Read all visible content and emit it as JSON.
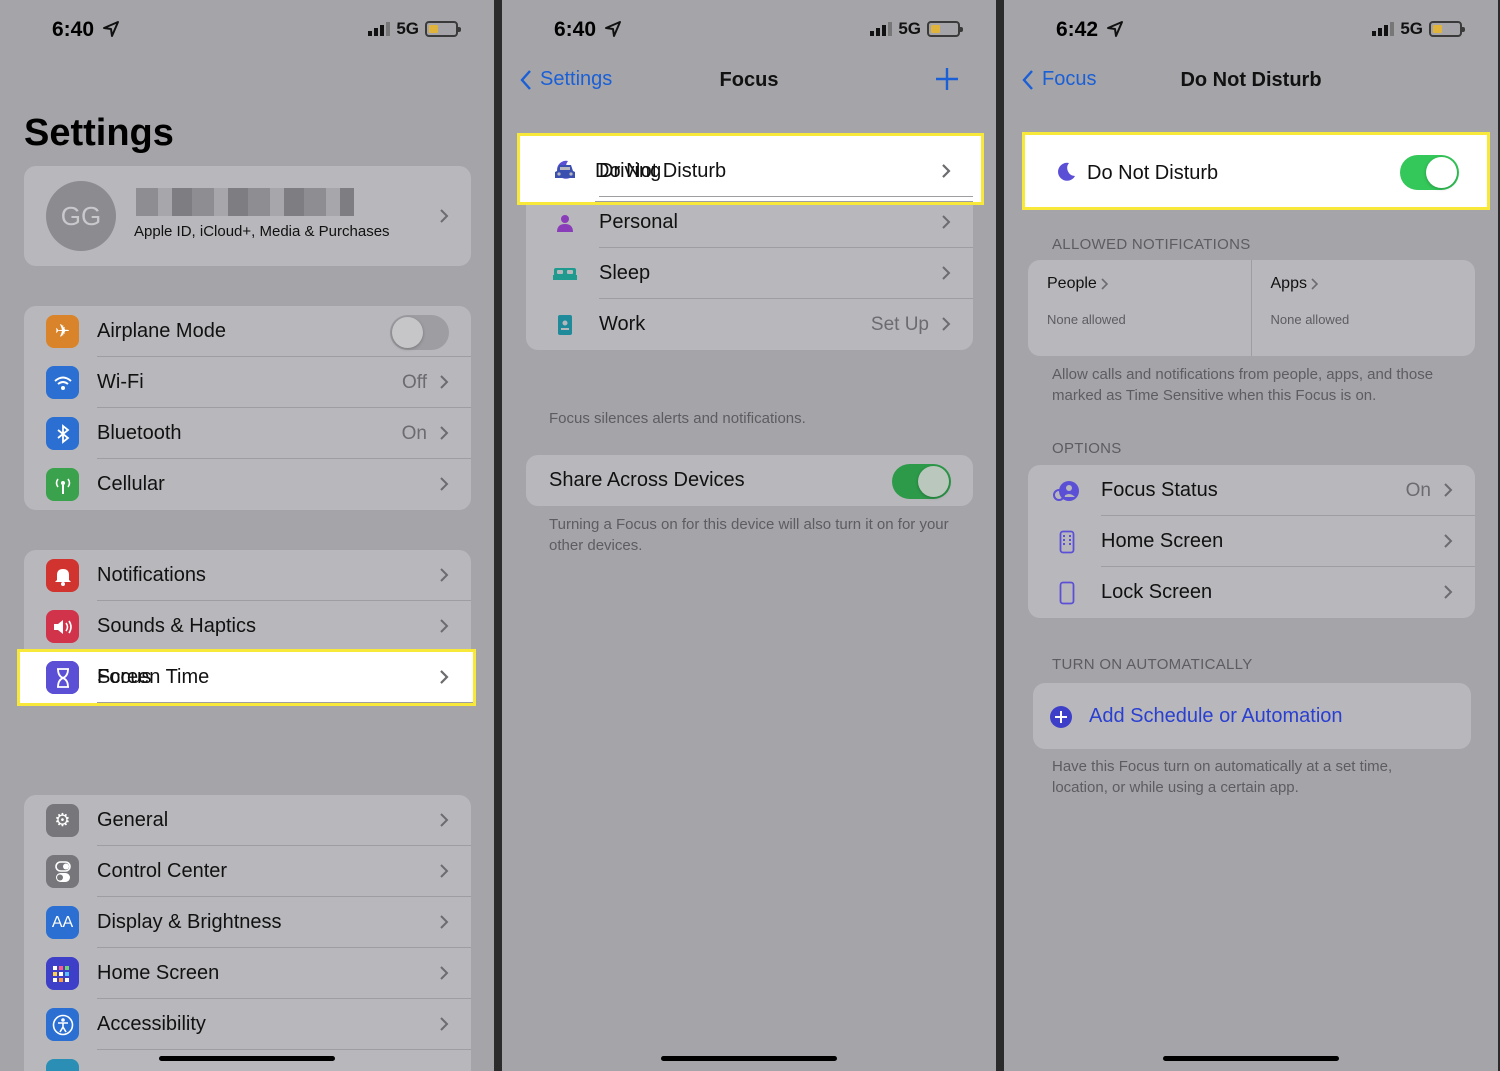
{
  "colors": {
    "accent": "#1a5fd6",
    "toggle_on": "#34c759",
    "highlight": "#f7e83a",
    "focus_purple": "#5b4fd6"
  },
  "screen1": {
    "status": {
      "time": "6:40",
      "network": "5G",
      "battery": 0.3
    },
    "title": "Settings",
    "profile": {
      "initials": "GG",
      "subtitle": "Apple ID, iCloud+, Media & Purchases"
    },
    "group1": [
      {
        "label": "Airplane Mode",
        "icon": "airplane-icon",
        "color": "#d9842a",
        "toggle": false
      },
      {
        "label": "Wi-Fi",
        "icon": "wifi-icon",
        "color": "#2a6fd1",
        "value": "Off"
      },
      {
        "label": "Bluetooth",
        "icon": "bluetooth-icon",
        "color": "#2a6fd1",
        "value": "On"
      },
      {
        "label": "Cellular",
        "icon": "antenna-icon",
        "color": "#3aa24c"
      }
    ],
    "group2": [
      {
        "label": "Notifications",
        "icon": "bell-icon",
        "color": "#d1342f"
      },
      {
        "label": "Sounds & Haptics",
        "icon": "speaker-icon",
        "color": "#d1344a"
      },
      {
        "label": "Focus",
        "icon": "moon-icon",
        "color": "#5b4fd6"
      },
      {
        "label": "Screen Time",
        "icon": "hourglass-icon",
        "color": "#5b4fd6"
      }
    ],
    "group3": [
      {
        "label": "General",
        "icon": "gear-icon",
        "color": "#77777b"
      },
      {
        "label": "Control Center",
        "icon": "switches-icon",
        "color": "#77777b"
      },
      {
        "label": "Display & Brightness",
        "icon": "text-size-icon",
        "color": "#2a6fd1"
      },
      {
        "label": "Home Screen",
        "icon": "app-grid-icon",
        "color": "#3d3fc8"
      },
      {
        "label": "Accessibility",
        "icon": "accessibility-icon",
        "color": "#2a6fd1"
      }
    ]
  },
  "screen2": {
    "status": {
      "time": "6:40",
      "network": "5G",
      "battery": 0.3
    },
    "nav": {
      "back": "Settings",
      "title": "Focus"
    },
    "focus_list": [
      {
        "label": "Do Not Disturb",
        "icon": "moon-icon",
        "color": "#5b4fd6"
      },
      {
        "label": "Driving",
        "icon": "car-icon",
        "color": "#3b4fb0"
      },
      {
        "label": "Personal",
        "icon": "person-icon",
        "color": "#8a3db8"
      },
      {
        "label": "Sleep",
        "icon": "bed-icon",
        "color": "#1f9a8f"
      },
      {
        "label": "Work",
        "icon": "badge-icon",
        "color": "#1f8a9a",
        "value": "Set Up"
      }
    ],
    "focus_footnote": "Focus silences alerts and notifications.",
    "share": {
      "label": "Share Across Devices",
      "toggle": true
    },
    "share_footnote": "Turning a Focus on for this device will also turn it on for your other devices."
  },
  "screen3": {
    "status": {
      "time": "6:42",
      "network": "5G",
      "battery": 0.3
    },
    "nav": {
      "back": "Focus",
      "title": "Do Not Disturb"
    },
    "dnd": {
      "label": "Do Not Disturb",
      "toggle": true
    },
    "allowed_header": "ALLOWED NOTIFICATIONS",
    "people": {
      "title": "People",
      "sub": "None allowed"
    },
    "apps": {
      "title": "Apps",
      "sub": "None allowed"
    },
    "allowed_footnote": "Allow calls and notifications from people, apps, and those marked as Time Sensitive when this Focus is on.",
    "options_header": "OPTIONS",
    "options": [
      {
        "label": "Focus Status",
        "icon": "focus-status-icon",
        "value": "On"
      },
      {
        "label": "Home Screen",
        "icon": "phone-grid-icon"
      },
      {
        "label": "Lock Screen",
        "icon": "phone-icon"
      }
    ],
    "auto_header": "TURN ON AUTOMATICALLY",
    "add_automation": "Add Schedule or Automation",
    "auto_footnote": "Have this Focus turn on automatically at a set time, location, or while using a certain app."
  }
}
